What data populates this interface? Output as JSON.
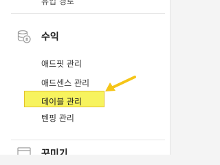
{
  "sidebar": {
    "previous_item_label": "유입 경로",
    "section": {
      "title": "수익",
      "icon": "coins-icon",
      "items": [
        {
          "label": "애드핏 관리"
        },
        {
          "label": "애드센스 관리"
        },
        {
          "label": "데이블 관리",
          "highlighted": true
        },
        {
          "label": "텐핑 관리"
        }
      ]
    },
    "next_section": {
      "title": "꾸미기",
      "icon": "window-icon"
    }
  },
  "annotation": {
    "highlight_color": "#f7f35e",
    "arrow_color": "#f5c518",
    "arrow_icon": "arrow-pointer-icon"
  }
}
